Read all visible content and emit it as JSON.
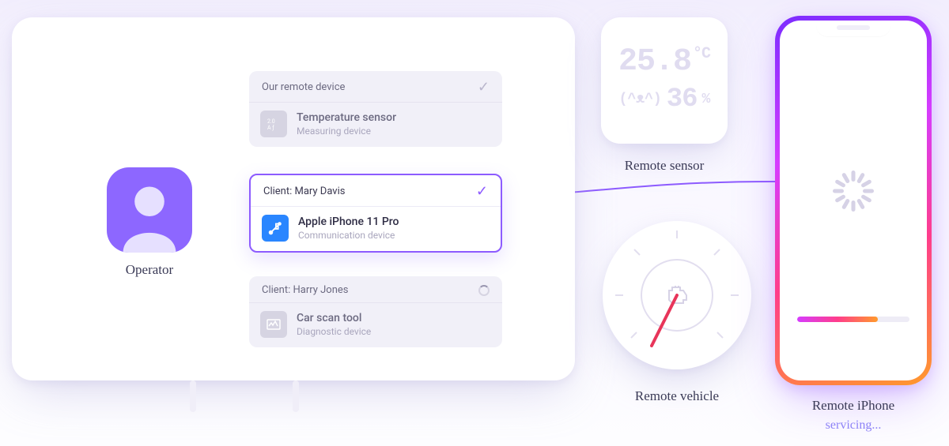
{
  "operator": {
    "label": "Operator"
  },
  "cards": [
    {
      "header": "Our remote device",
      "status": "done",
      "device_name": "Temperature sensor",
      "device_type": "Measuring device",
      "active": false
    },
    {
      "header": "Client: Mary Davis",
      "status": "done",
      "device_name": "Apple iPhone 11 Pro",
      "device_type": "Communication device",
      "active": true
    },
    {
      "header": "Client: Harry Jones",
      "status": "loading",
      "device_name": "Car scan tool",
      "device_type": "Diagnostic device",
      "active": false
    }
  ],
  "sensor": {
    "label": "Remote sensor",
    "temperature": "25.8",
    "temp_unit": "°C",
    "humidity": "36",
    "humidity_unit": "%"
  },
  "vehicle": {
    "label": "Remote vehicle"
  },
  "phone": {
    "label": "Remote iPhone",
    "status": "servicing...",
    "progress_pct": 72
  },
  "colors": {
    "accent": "#8d5bff",
    "blue": "#2a86ff"
  }
}
